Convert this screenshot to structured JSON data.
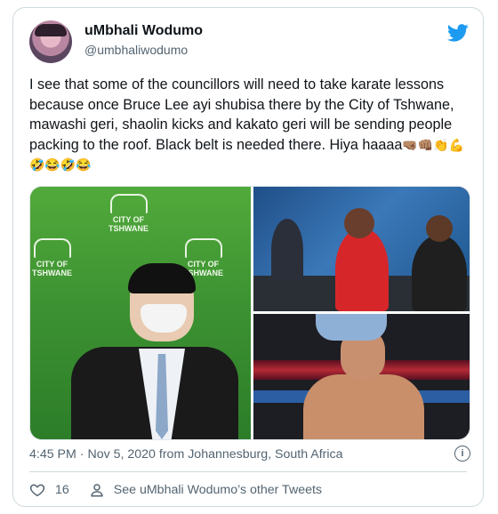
{
  "user": {
    "name": "uMbhali Wodumo",
    "handle": "@umbhaliwodumo"
  },
  "tweet": {
    "text": "I see that some of the councillors will need to take karate lessons because once Bruce Lee ayi shubisa there by the City of Tshwane, mawashi geri, shaolin kicks and kakato geri will be sending people packing to the roof. Black belt is needed there. Hiya haaaa",
    "emojis": "🤜🏽👊🏽👏💪🤣😂🤣😂"
  },
  "media": {
    "logo_lines": [
      "CITY OF",
      "TSHWANE"
    ],
    "logo_left_lines": [
      "CITY OF",
      "TSHWANE"
    ],
    "logo_right_lines": [
      "CITY OF",
      "TSHWANE"
    ]
  },
  "meta": {
    "timestamp": "4:45 PM · Nov 5, 2020 from Johannesburg, South Africa",
    "info_glyph": "i"
  },
  "actions": {
    "like_count": "16",
    "other_tweets_label": "See uMbhali Wodumo’s other Tweets"
  },
  "colors": {
    "brand_blue": "#1d9bf0",
    "secondary_text": "#536471",
    "border": "#cfd9de"
  },
  "icons": [
    "twitter-bird-icon",
    "heart-icon",
    "person-icon",
    "info-icon"
  ]
}
